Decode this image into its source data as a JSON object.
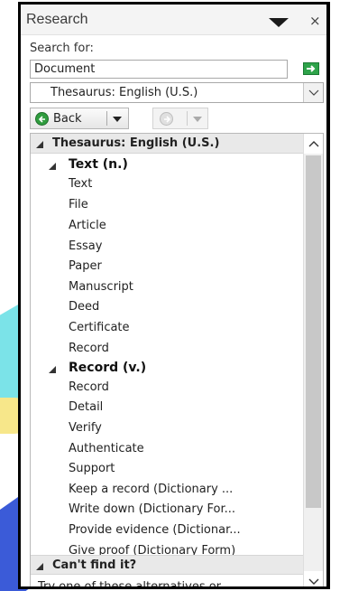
{
  "panel": {
    "title": "Research",
    "close_symbol": "×"
  },
  "search": {
    "label": "Search for:",
    "value": "Document",
    "go_icon": "go-arrow-icon"
  },
  "source": {
    "selected": "Thesaurus: English (U.S.)"
  },
  "navigation": {
    "back_label": "Back",
    "back_icon": "back-arrow-icon",
    "forward_icon": "forward-arrow-icon"
  },
  "results": {
    "header": "Thesaurus: English (U.S.)",
    "groups": [
      {
        "heading": "Text (n.)",
        "items": [
          "Text",
          "File",
          "Article",
          "Essay",
          "Paper",
          "Manuscript",
          "Deed",
          "Certificate",
          "Record"
        ]
      },
      {
        "heading": "Record (v.)",
        "items": [
          "Record",
          "Detail",
          "Verify",
          "Authenticate",
          "Support",
          "Keep a record (Dictionary ...",
          "Write down (Dictionary For...",
          "Provide evidence (Dictionar...",
          "Give proof (Dictionary Form)"
        ]
      }
    ],
    "cant_find_header": "Can't find it?",
    "cant_find_text": "Try one of these alternatives or"
  },
  "colors": {
    "go_button": "#2ea34a",
    "back_icon": "#2f9c3e",
    "section_header_bg": "#e9e9e9",
    "scroll_thumb": "#c8c8c8"
  }
}
